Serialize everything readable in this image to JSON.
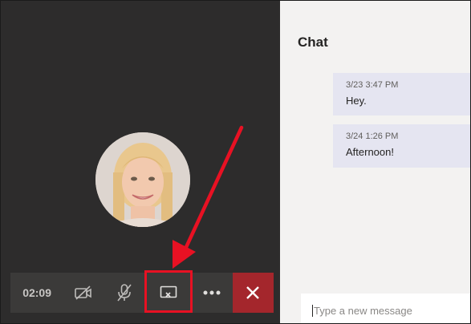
{
  "call": {
    "timer": "02:09",
    "controls": {
      "video_icon": "video-off-icon",
      "mic_icon": "mic-off-icon",
      "share_icon": "stop-sharing-icon",
      "more_icon": "more-options-icon",
      "hangup_icon": "hang-up-icon"
    }
  },
  "chat": {
    "title": "Chat",
    "messages": [
      {
        "timestamp": "3/23 3:47 PM",
        "text": "Hey."
      },
      {
        "timestamp": "3/24 1:26 PM",
        "text": "Afternoon!"
      }
    ],
    "compose_placeholder": "Type a new message"
  },
  "colors": {
    "call_background": "#2d2c2c",
    "control_bar": "#3b3a39",
    "hangup": "#a4262c",
    "message_bubble": "#e5e5f1",
    "annotation": "#e81123"
  }
}
